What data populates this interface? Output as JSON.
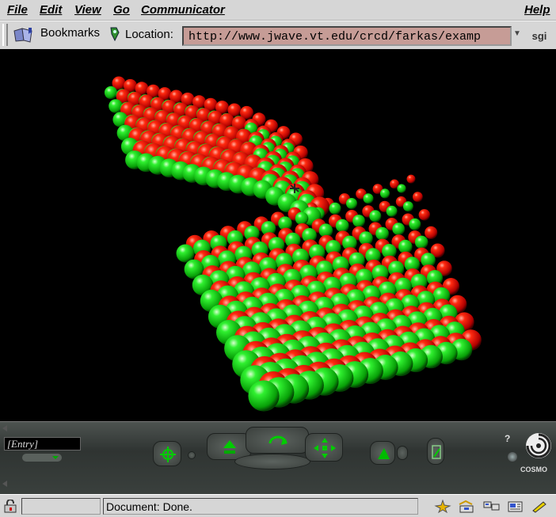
{
  "menubar": {
    "items": [
      {
        "label": "File"
      },
      {
        "label": "Edit"
      },
      {
        "label": "View"
      },
      {
        "label": "Go"
      },
      {
        "label": "Communicator"
      },
      {
        "label": "Help"
      }
    ]
  },
  "location_bar": {
    "bookmarks_label": "Bookmarks",
    "location_label": "Location:",
    "url": "http://www.jwave.vt.edu/crcd/farkas/examp",
    "brand": "sgi"
  },
  "viewer": {
    "sphere_colors": {
      "red": "#e00000",
      "green": "#10d010"
    }
  },
  "cosmo": {
    "viewpoint_entry": "[Entry]",
    "brand": "COSMO"
  },
  "statusbar": {
    "status_text": "Document: Done."
  }
}
